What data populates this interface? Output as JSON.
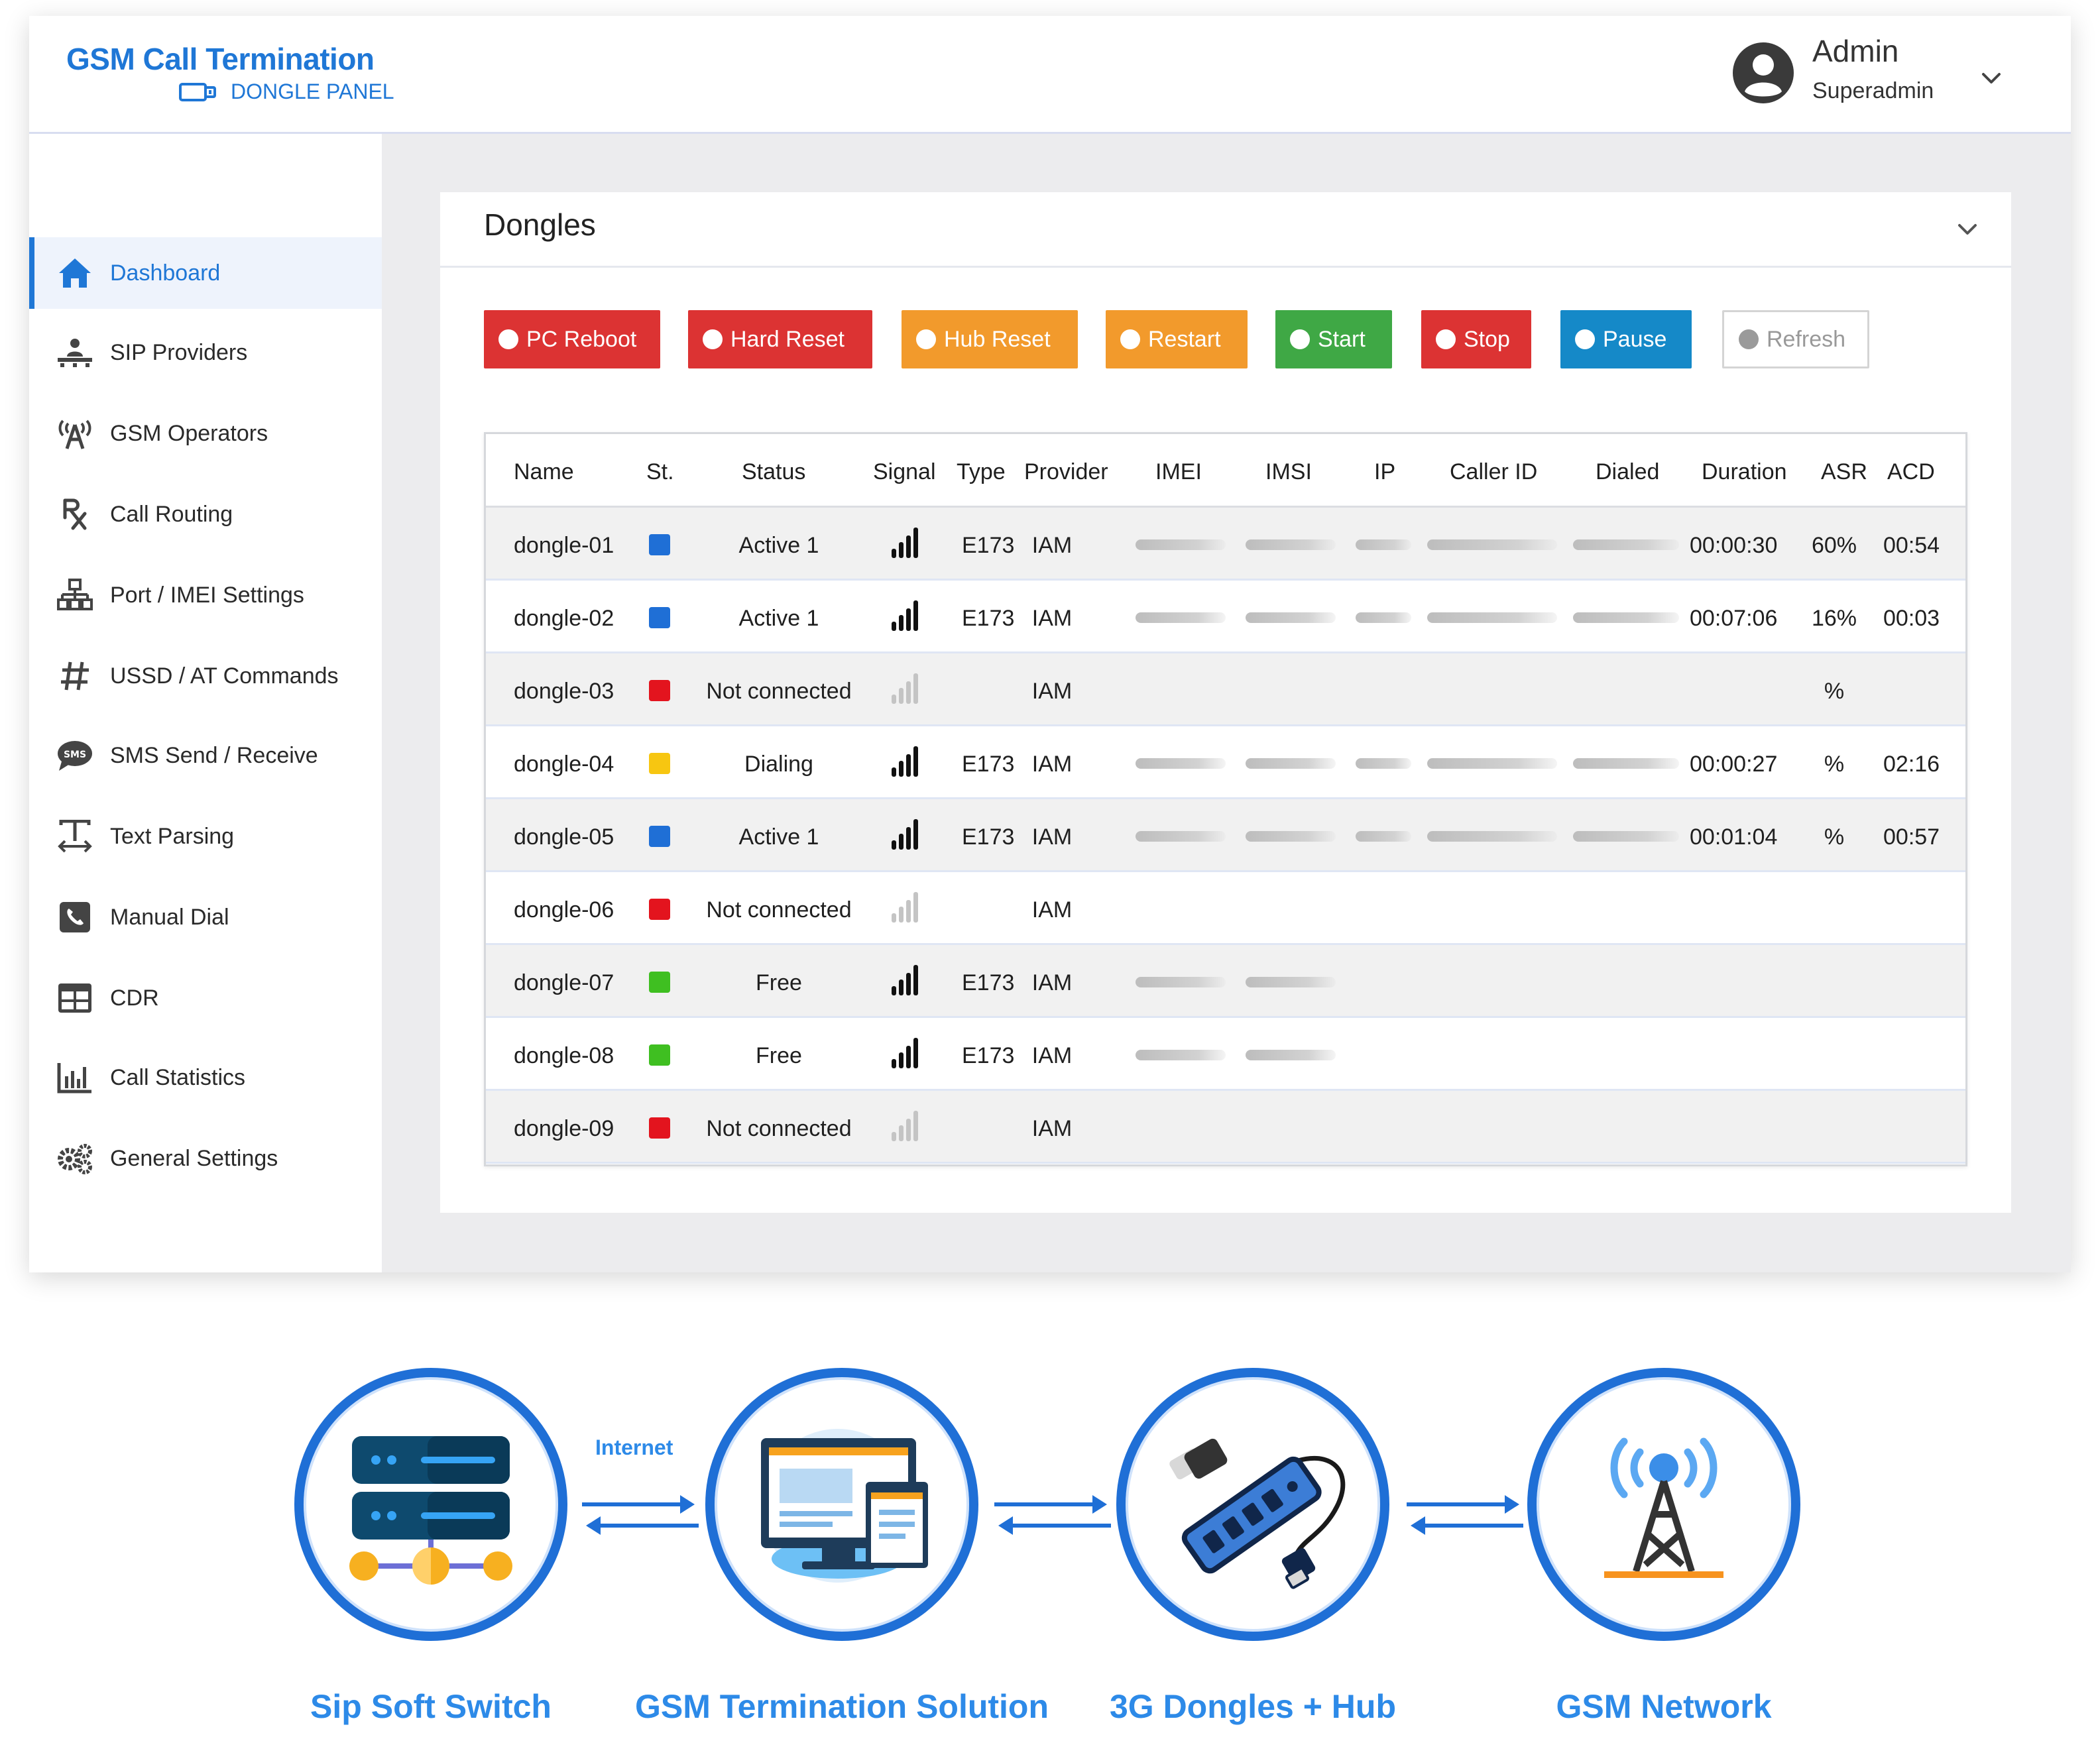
{
  "app": {
    "brand": {
      "title": "GSM Call Termination",
      "subtitle": "DONGLE PANEL"
    },
    "user": {
      "name": "Admin",
      "role": "Superadmin"
    }
  },
  "sidebar": {
    "items": [
      {
        "label": "Dashboard",
        "icon": "home-icon",
        "active": true
      },
      {
        "label": "SIP Providers",
        "icon": "sip-provider-icon"
      },
      {
        "label": "GSM Operators",
        "icon": "antenna-icon"
      },
      {
        "label": "Call Routing",
        "icon": "rx-icon"
      },
      {
        "label": "Port / IMEI Settings",
        "icon": "network-icon"
      },
      {
        "label": "USSD / AT Commands",
        "icon": "hash-icon"
      },
      {
        "label": "SMS Send / Receive",
        "icon": "sms-icon"
      },
      {
        "label": "Text Parsing",
        "icon": "text-parsing-icon"
      },
      {
        "label": "Manual Dial",
        "icon": "phone-icon"
      },
      {
        "label": "CDR",
        "icon": "table-icon"
      },
      {
        "label": "Call Statistics",
        "icon": "bar-chart-icon"
      },
      {
        "label": "General Settings",
        "icon": "gears-icon"
      }
    ]
  },
  "card": {
    "title": "Dongles",
    "buttons": [
      {
        "label": "PC Reboot",
        "color": "#dc3333"
      },
      {
        "label": "Hard Reset",
        "color": "#dc3333"
      },
      {
        "label": "Hub Reset",
        "color": "#f29a2c"
      },
      {
        "label": "Restart",
        "color": "#f29a2c"
      },
      {
        "label": "Start",
        "color": "#3fa845"
      },
      {
        "label": "Stop",
        "color": "#dc3333"
      },
      {
        "label": "Pause",
        "color": "#1589c8"
      },
      {
        "label": "Refresh",
        "color": "#ffffff"
      }
    ]
  },
  "table": {
    "columns": [
      "Name",
      "St.",
      "Status",
      "Signal",
      "Type",
      "Provider",
      "IMEI",
      "IMSI",
      "IP",
      "Caller ID",
      "Dialed",
      "Duration",
      "ASR",
      "ACD"
    ],
    "status_colors": {
      "active": "#1f6fd6",
      "not_connected": "#e3141e",
      "dialing": "#f7c611",
      "free": "#3fbf21"
    },
    "rows": [
      {
        "name": "dongle-01",
        "st": "active",
        "status": "Active 1",
        "signal": "strong",
        "type": "E173",
        "provider": "IAM",
        "redacted": [
          "imei",
          "imsi",
          "ip",
          "callerid",
          "dialed"
        ],
        "duration": "00:00:30",
        "asr": "60%",
        "acd": "00:54"
      },
      {
        "name": "dongle-02",
        "st": "active",
        "status": "Active 1",
        "signal": "strong",
        "type": "E173",
        "provider": "IAM",
        "redacted": [
          "imei",
          "imsi",
          "ip",
          "callerid",
          "dialed"
        ],
        "duration": "00:07:06",
        "asr": "16%",
        "acd": "00:03"
      },
      {
        "name": "dongle-03",
        "st": "not_connected",
        "status": "Not connected",
        "signal": "none",
        "type": "",
        "provider": "IAM",
        "redacted": [],
        "duration": "",
        "asr": "%",
        "acd": ""
      },
      {
        "name": "dongle-04",
        "st": "dialing",
        "status": "Dialing",
        "signal": "strong",
        "type": "E173",
        "provider": "IAM",
        "redacted": [
          "imei",
          "imsi",
          "ip",
          "callerid",
          "dialed"
        ],
        "duration": "00:00:27",
        "asr": "%",
        "acd": "02:16"
      },
      {
        "name": "dongle-05",
        "st": "active",
        "status": "Active 1",
        "signal": "strong",
        "type": "E173",
        "provider": "IAM",
        "redacted": [
          "imei",
          "imsi",
          "ip",
          "callerid",
          "dialed"
        ],
        "duration": "00:01:04",
        "asr": "%",
        "acd": "00:57"
      },
      {
        "name": "dongle-06",
        "st": "not_connected",
        "status": "Not connected",
        "signal": "none",
        "type": "",
        "provider": "IAM",
        "redacted": [],
        "duration": "",
        "asr": "",
        "acd": ""
      },
      {
        "name": "dongle-07",
        "st": "free",
        "status": "Free",
        "signal": "strong",
        "type": "E173",
        "provider": "IAM",
        "redacted": [
          "imei",
          "imsi"
        ],
        "duration": "",
        "asr": "",
        "acd": ""
      },
      {
        "name": "dongle-08",
        "st": "free",
        "status": "Free",
        "signal": "strong",
        "type": "E173",
        "provider": "IAM",
        "redacted": [
          "imei",
          "imsi"
        ],
        "duration": "",
        "asr": "",
        "acd": ""
      },
      {
        "name": "dongle-09",
        "st": "not_connected",
        "status": "Not connected",
        "signal": "none",
        "type": "",
        "provider": "IAM",
        "redacted": [],
        "duration": "",
        "asr": "",
        "acd": ""
      }
    ]
  },
  "diagram": {
    "link_label": "Internet",
    "nodes": [
      {
        "label": "Sip Soft Switch",
        "icon": "server-icon"
      },
      {
        "label": "GSM Termination Solution",
        "icon": "monitor-icon"
      },
      {
        "label": "3G Dongles + Hub",
        "icon": "usb-hub-icon"
      },
      {
        "label": "GSM Network",
        "icon": "cell-tower-icon"
      }
    ],
    "accent": "#1f6fd6"
  }
}
